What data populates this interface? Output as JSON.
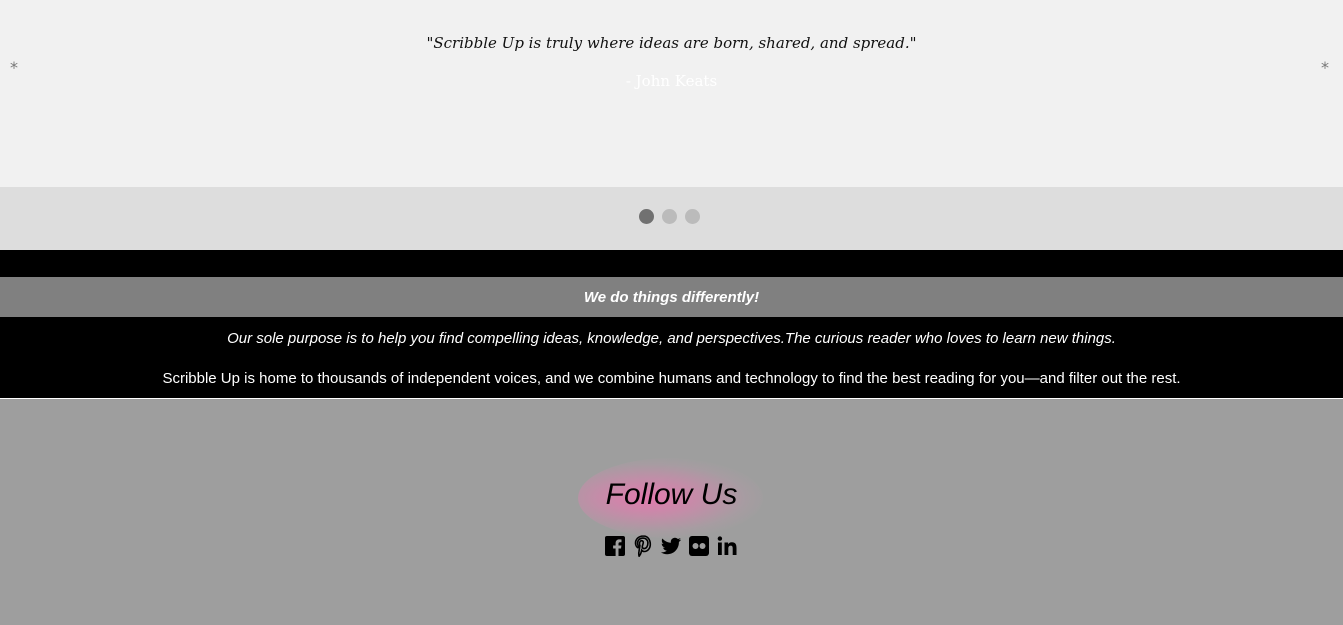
{
  "slideshow": {
    "quote": "\"Scribble Up is truly where ideas are born, shared, and spread.\"",
    "author": "- John Keats",
    "prev_glyph": "*",
    "next_glyph": "*",
    "dots_count": 3,
    "active_dot": 1
  },
  "about": {
    "tagline": "We do things differently!",
    "purpose": "Our sole purpose is to help you find compelling ideas, knowledge, and perspectives.The curious reader who loves to learn new things.",
    "home": "Scribble Up is home to thousands of independent voices, and we combine humans and technology to find the best reading for you—and filter out the rest."
  },
  "follow": {
    "heading": "Follow Us",
    "icons": [
      "facebook-icon",
      "pinterest-icon",
      "twitter-icon",
      "flickr-icon",
      "linkedin-icon"
    ]
  },
  "colors": {
    "slide_bg": "#f1f1f1",
    "dots_bg": "#dddddd",
    "dark_band": "#000000",
    "tagline_band": "#808080",
    "footer_bg": "#9e9e9e",
    "glow": "#e678af"
  }
}
